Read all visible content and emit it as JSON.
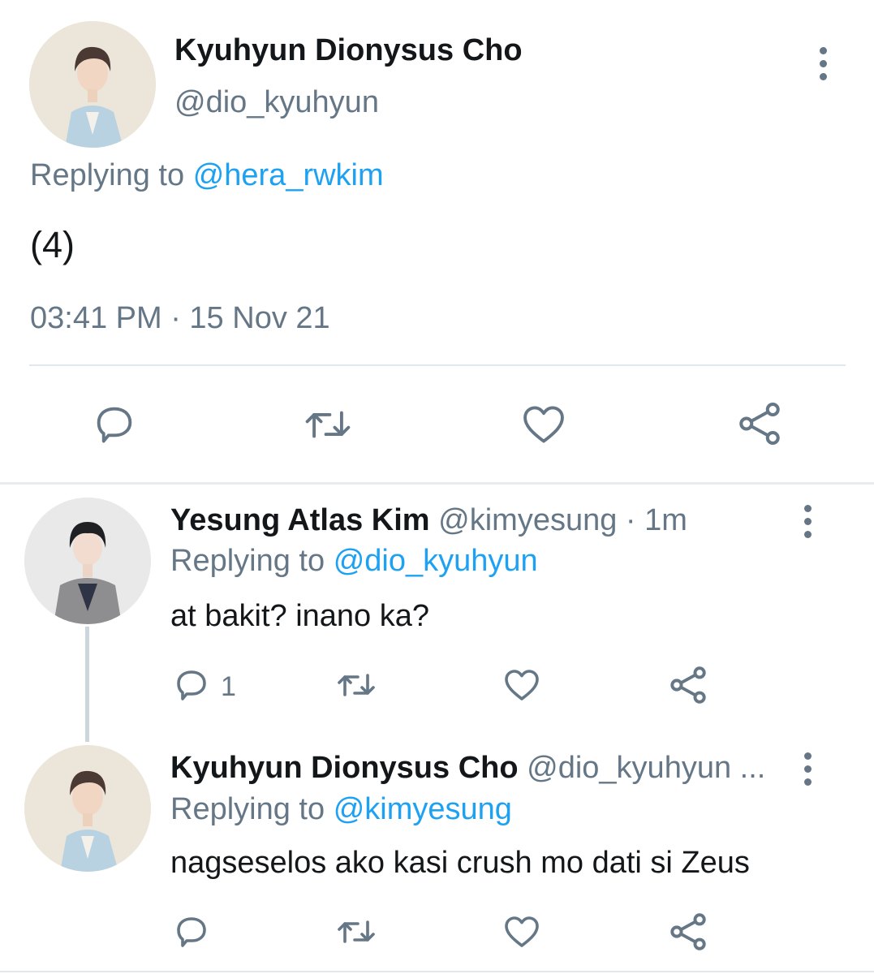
{
  "main_tweet": {
    "display_name": "Kyuhyun Dionysus Cho",
    "handle": "@dio_kyuhyun",
    "replying_prefix": "Replying to",
    "replying_to": "@hera_rwkim",
    "text": "(4)",
    "timestamp": "03:41 PM · 15 Nov 21",
    "actions": [
      "reply-icon",
      "retweet-icon",
      "like-icon",
      "share-icon"
    ]
  },
  "replies": [
    {
      "display_name": "Yesung Atlas Kim",
      "handle_time": "@kimyesung · 1m",
      "replying_prefix": "Replying to",
      "replying_to": "@dio_kyuhyun",
      "text": "at bakit? inano ka?",
      "reply_count": "1"
    },
    {
      "display_name": "Kyuhyun Dionysus Cho",
      "handle_time": "@dio_kyuhyun ...",
      "replying_prefix": "Replying to",
      "replying_to": "@kimyesung",
      "text": "nagseselos ako kasi crush mo dati si Zeus",
      "reply_count": ""
    }
  ],
  "colors": {
    "text": "#14171a",
    "secondary": "#657786",
    "accent": "#1da1f2",
    "divider": "#e1e8ed"
  }
}
